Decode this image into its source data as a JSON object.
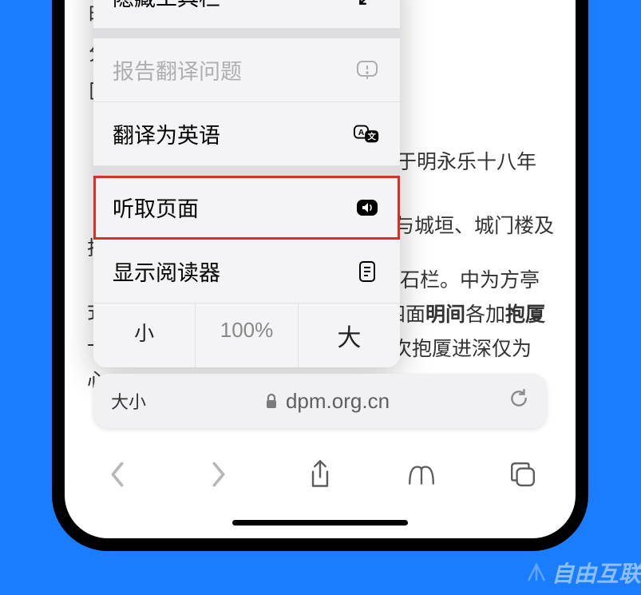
{
  "menu": {
    "hide_toolbar": "隐藏工具栏",
    "report_translation": "报告翻译问题",
    "translate_english": "翻译为英语",
    "listen_page": "听取页面",
    "show_reader": "显示阅读器",
    "zoom_small": "小",
    "zoom_level": "100%",
    "zoom_large": "大"
  },
  "address_bar": {
    "left_label": "大小",
    "domain": "dpm.org.cn"
  },
  "content": {
    "char1": "時",
    "char2": "分",
    "char3": "区",
    "line1": "于明永乐十八年",
    "line2": "与城垣、城门楼及",
    "char4": "护",
    "line3a": "以石栏。中为方亭",
    "char5": "式",
    "line3b_pre": "四面",
    "line3b_bold1": "明间",
    "line3b_mid": "各加",
    "line3b_bold2": "抱厦",
    "char6": "一",
    "line4": "次抱厦进深仅为",
    "char7": "心"
  },
  "watermark": "自由互联"
}
